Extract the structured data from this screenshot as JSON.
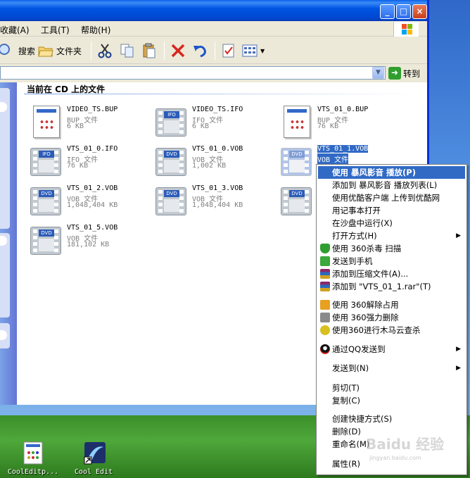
{
  "window": {
    "buttons": [
      "_",
      "□",
      "×"
    ]
  },
  "menubar": {
    "items": [
      "收藏(A)",
      "工具(T)",
      "帮助(H)"
    ]
  },
  "toolbar": {
    "search_label": "搜索",
    "folders_label": "文件夹"
  },
  "address": {
    "go_label": "转到"
  },
  "content": {
    "section_title": "当前在 CD 上的文件",
    "files": [
      {
        "name": "VIDEO_TS.BUP",
        "type": "BUP 文件",
        "size": "6 KB",
        "icon": "document-icon"
      },
      {
        "name": "VIDEO_TS.IFO",
        "type": "IFO 文件",
        "size": "6 KB",
        "icon": "ifo-film-icon",
        "label": "IFO"
      },
      {
        "name": "VTS_01_0.BUP",
        "type": "BUP 文件",
        "size": "76 KB",
        "icon": "document-icon"
      },
      {
        "name": "VTS_01_0.IFO",
        "type": "IFO 文件",
        "size": "76 KB",
        "icon": "ifo-film-icon",
        "label": "IFO"
      },
      {
        "name": "VTS_01_0.VOB",
        "type": "VOB 文件",
        "size": "1,002 KB",
        "icon": "dvd-film-icon",
        "label": "DVD"
      },
      {
        "name": "VTS_01_1.VOB",
        "type": "VOB 文件",
        "size": "",
        "icon": "dvd-film-icon",
        "label": "DVD"
      },
      {
        "name": "VTS_01_2.VOB",
        "type": "VOB 文件",
        "size": "1,048,404 KB",
        "icon": "dvd-film-icon",
        "label": "DVD"
      },
      {
        "name": "VTS_01_3.VOB",
        "type": "VOB 文件",
        "size": "1,048,404 KB",
        "icon": "dvd-film-icon",
        "label": "DVD"
      },
      {
        "name": "",
        "type": "",
        "size": "",
        "icon": "dvd-film-icon",
        "label": "DVD"
      },
      {
        "name": "VTS_01_5.VOB",
        "type": "VOB 文件",
        "size": "181,102 KB",
        "icon": "dvd-film-icon",
        "label": "DVD"
      }
    ]
  },
  "context_menu": {
    "items": [
      {
        "label": "使用 暴风影音 播放(P)",
        "highlight": true
      },
      {
        "label": "添加到 暴风影音 播放列表(L)"
      },
      {
        "label": "使用优酷客户端 上传到优酷网"
      },
      {
        "label": "用记事本打开"
      },
      {
        "label": "在沙盘中运行(X)"
      },
      {
        "label": "打开方式(H)",
        "submenu": true
      },
      {
        "label": "使用 360杀毒 扫描",
        "icon": "360-shield-icon"
      },
      {
        "label": "发送到手机",
        "icon": "phone-send-icon"
      },
      {
        "label": "添加到压缩文件(A)...",
        "icon": "winrar-icon"
      },
      {
        "label": "添加到 \"VTS_01_1.rar\"(T)",
        "icon": "winrar-icon"
      },
      {
        "sep": true
      },
      {
        "label": "使用 360解除占用",
        "icon": "360-unlock-icon"
      },
      {
        "label": "使用 360强力删除",
        "icon": "360-delete-icon"
      },
      {
        "label": "使用360进行木马云查杀",
        "icon": "360-cloud-scan-icon"
      },
      {
        "sep": true
      },
      {
        "label": "通过QQ发送到",
        "icon": "qq-icon",
        "submenu": true
      },
      {
        "sep": true
      },
      {
        "label": "发送到(N)",
        "submenu": true
      },
      {
        "sep": true
      },
      {
        "label": "剪切(T)"
      },
      {
        "label": "复制(C)"
      },
      {
        "sep": true
      },
      {
        "label": "创建快捷方式(S)"
      },
      {
        "label": "删除(D)"
      },
      {
        "label": "重命名(M)"
      },
      {
        "sep": true
      },
      {
        "label": "属性(R)"
      }
    ]
  },
  "watermark": {
    "text": "Baidu 经验",
    "sub": "jingyan.baidu.com"
  },
  "desktop": {
    "icons": [
      {
        "label": "CoolEditp...",
        "icon": "cooledit-doc-icon"
      },
      {
        "label": "Cool Edit",
        "icon": "cooledit-shortcut-icon"
      }
    ]
  },
  "colors": {
    "selection": "#316ac5",
    "titlebar": "#0054e3",
    "leftpane": "#6375d6"
  }
}
